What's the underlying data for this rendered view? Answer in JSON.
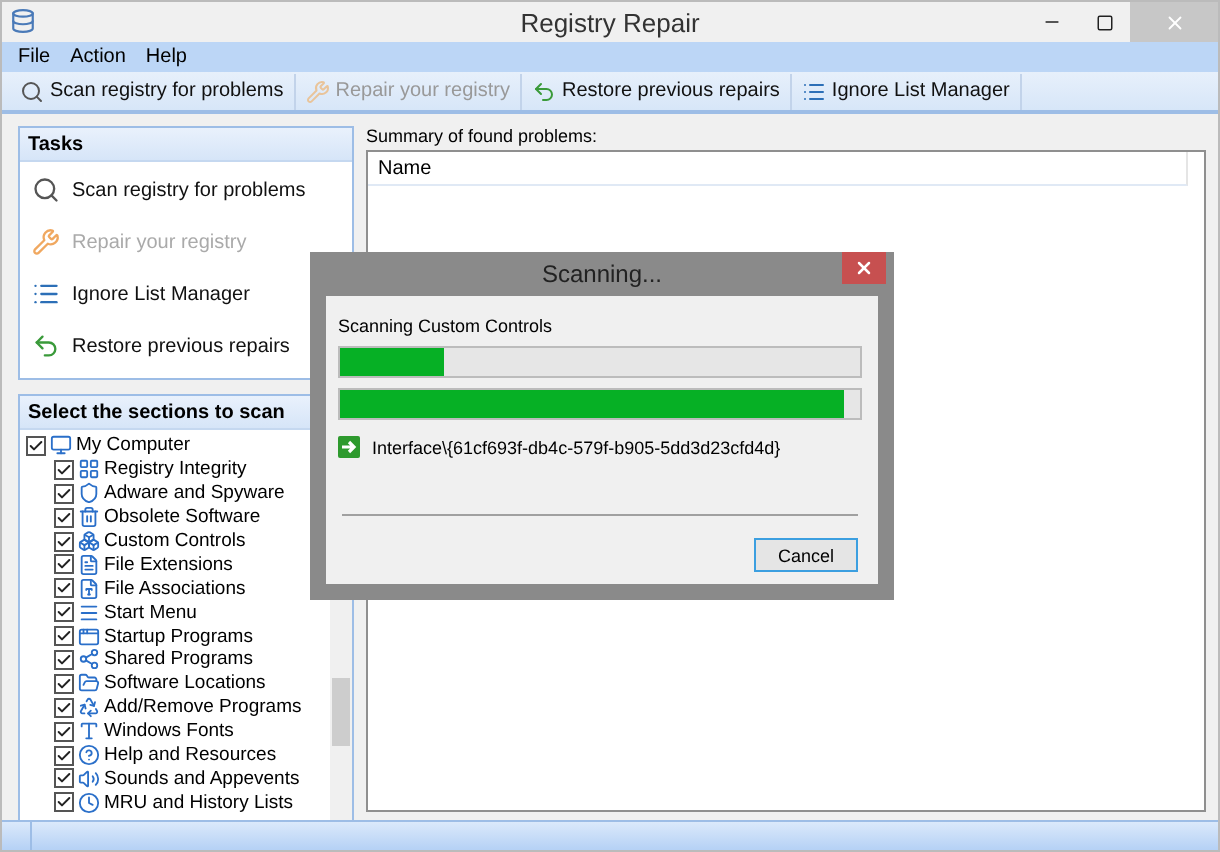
{
  "window": {
    "title": "Registry Repair"
  },
  "menu": [
    "File",
    "Action",
    "Help"
  ],
  "toolbar": [
    {
      "label": "Scan registry for problems",
      "disabled": false
    },
    {
      "label": "Repair your registry",
      "disabled": true
    },
    {
      "label": "Restore previous repairs",
      "disabled": false
    },
    {
      "label": "Ignore List Manager",
      "disabled": false
    }
  ],
  "tasks": {
    "title": "Tasks",
    "items": [
      {
        "label": "Scan registry for problems",
        "disabled": false
      },
      {
        "label": "Repair your registry",
        "disabled": true
      },
      {
        "label": "Ignore List Manager",
        "disabled": false
      },
      {
        "label": "Restore previous repairs",
        "disabled": false
      }
    ]
  },
  "sections": {
    "title": "Select the sections to scan",
    "tree": [
      {
        "label": "My Computer",
        "checked": true,
        "children": [
          {
            "label": "Registry Integrity",
            "checked": true
          },
          {
            "label": "Adware and Spyware",
            "checked": true
          },
          {
            "label": "Obsolete Software",
            "checked": true
          },
          {
            "label": "Custom Controls",
            "checked": true
          },
          {
            "label": "File Extensions",
            "checked": true
          },
          {
            "label": "File Associations",
            "checked": true
          },
          {
            "label": "Start Menu",
            "checked": true
          },
          {
            "label": "Startup Programs",
            "checked": true
          },
          {
            "label": "Shared Programs",
            "checked": true
          },
          {
            "label": "Software Locations",
            "checked": true
          },
          {
            "label": "Add/Remove Programs",
            "checked": true
          },
          {
            "label": "Windows Fonts",
            "checked": true
          },
          {
            "label": "Help and Resources",
            "checked": true
          },
          {
            "label": "Sounds and Appevents",
            "checked": true
          },
          {
            "label": "MRU and History Lists",
            "checked": true
          }
        ]
      }
    ]
  },
  "summary": {
    "label": "Summary of found problems:",
    "columns": [
      "Name"
    ]
  },
  "dialog": {
    "title": "Scanning...",
    "status": "Scanning Custom Controls",
    "progress": [
      {
        "level": 0.2
      },
      {
        "level": 0.97
      }
    ],
    "current_item": "Interface\\{61cf693f-db4c-579f-b905-5dd3d23cfd4d}",
    "buttons": [
      "Cancel"
    ]
  }
}
